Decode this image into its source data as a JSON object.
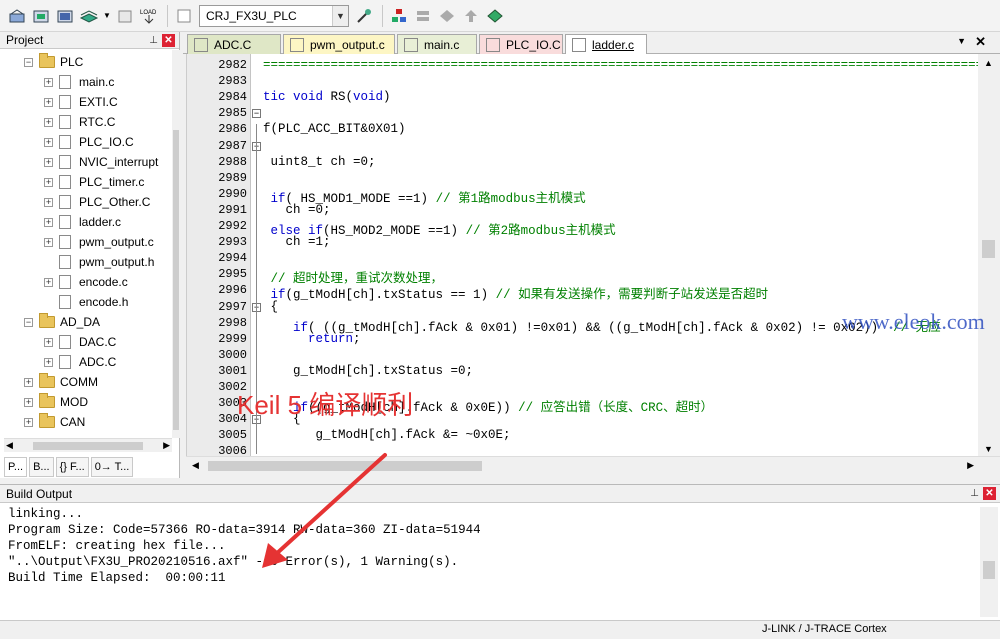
{
  "toolbar": {
    "target_combo": "CRJ_FX3U_PLC"
  },
  "project": {
    "title": "Project",
    "pin_icon": "pin-icon",
    "tree": [
      {
        "label": "PLC",
        "kind": "folder",
        "expanded": true,
        "level": 1
      },
      {
        "label": "main.c",
        "kind": "file",
        "level": 2
      },
      {
        "label": "EXTI.C",
        "kind": "file",
        "level": 2
      },
      {
        "label": "RTC.C",
        "kind": "file",
        "level": 2
      },
      {
        "label": "PLC_IO.C",
        "kind": "file",
        "level": 2
      },
      {
        "label": "NVIC_interrupt",
        "kind": "file",
        "level": 2
      },
      {
        "label": "PLC_timer.c",
        "kind": "file",
        "level": 2
      },
      {
        "label": "PLC_Other.C",
        "kind": "file",
        "level": 2
      },
      {
        "label": "ladder.c",
        "kind": "file",
        "level": 2
      },
      {
        "label": "pwm_output.c",
        "kind": "file",
        "level": 2
      },
      {
        "label": "pwm_output.h",
        "kind": "header",
        "level": 2
      },
      {
        "label": "encode.c",
        "kind": "file",
        "level": 2
      },
      {
        "label": "encode.h",
        "kind": "header",
        "level": 2
      },
      {
        "label": "AD_DA",
        "kind": "folder",
        "expanded": true,
        "level": 1
      },
      {
        "label": "DAC.C",
        "kind": "file",
        "level": 2
      },
      {
        "label": "ADC.C",
        "kind": "file",
        "level": 2
      },
      {
        "label": "COMM",
        "kind": "folder",
        "expanded": false,
        "level": 1
      },
      {
        "label": "MOD",
        "kind": "folder",
        "expanded": false,
        "level": 1
      },
      {
        "label": "CAN",
        "kind": "folder",
        "expanded": false,
        "level": 1
      }
    ],
    "bottom_tabs": [
      "P...",
      "B...",
      "{} F...",
      "0→ T..."
    ]
  },
  "editor": {
    "tabs": [
      {
        "label": "ADC.C",
        "color": "#dfe7c6"
      },
      {
        "label": "pwm_output.c",
        "color": "#fdf6c4"
      },
      {
        "label": "main.c",
        "color": "#e8efd6"
      },
      {
        "label": "PLC_IO.C",
        "color": "#f9dcdc"
      },
      {
        "label": "ladder.c",
        "color": "#ffffff"
      }
    ],
    "close": "✕",
    "lines": [
      {
        "n": "2982",
        "html": "<span class=\"cm\">=========================================================================================================</span>"
      },
      {
        "n": "2983",
        "html": ""
      },
      {
        "n": "2984",
        "html": "<span class=\"kw\">tic void</span> RS(<span class=\"kw\">void</span>)"
      },
      {
        "n": "2985",
        "html": ""
      },
      {
        "n": "2986",
        "html": "f(PLC_ACC_BIT&amp;0X01)"
      },
      {
        "n": "2987",
        "html": ""
      },
      {
        "n": "2988",
        "html": " uint8_t ch =0;"
      },
      {
        "n": "2989",
        "html": ""
      },
      {
        "n": "2990",
        "html": " <span class=\"kw\">if</span>( HS_MOD1_MODE ==1) <span class=\"cm\">// 第1路modbus主机模式</span>"
      },
      {
        "n": "2991",
        "html": "   ch =0;"
      },
      {
        "n": "2992",
        "html": " <span class=\"kw\">else if</span>(HS_MOD2_MODE ==1) <span class=\"cm\">// 第2路modbus主机模式</span>"
      },
      {
        "n": "2993",
        "html": "   ch =1;"
      },
      {
        "n": "2994",
        "html": ""
      },
      {
        "n": "2995",
        "html": " <span class=\"cm\">// 超时处理，重试次数处理，</span>"
      },
      {
        "n": "2996",
        "html": " <span class=\"kw\">if</span>(g_tModH[ch].txStatus == 1) <span class=\"cm\">// 如果有发送操作，需要判断子站发送是否超时</span>"
      },
      {
        "n": "2997",
        "html": " {"
      },
      {
        "n": "2998",
        "html": "    <span class=\"kw\">if</span>( ((g_tModH[ch].fAck &amp; 0x01) !=0x01) &amp;&amp; ((g_tModH[ch].fAck &amp; 0x02) != 0x02))  <span class=\"cm\">// 无应</span>"
      },
      {
        "n": "2999",
        "html": "      <span class=\"kw\">return</span>;"
      },
      {
        "n": "3000",
        "html": ""
      },
      {
        "n": "3001",
        "html": "    g_tModH[ch].txStatus =0;"
      },
      {
        "n": "3002",
        "html": ""
      },
      {
        "n": "3003",
        "html": "    <span class=\"kw\">if</span>((g_tModH[ch].fAck &amp; 0x0E)) <span class=\"cm\">// 应答出错（长度、CRC、超时）</span>"
      },
      {
        "n": "3004",
        "html": "    {"
      },
      {
        "n": "3005",
        "html": "       g_tModH[ch].fAck &amp;= ~0x0E;"
      },
      {
        "n": "3006",
        "html": ""
      }
    ],
    "folds": [
      2985,
      2987,
      2997,
      3004
    ]
  },
  "build": {
    "title": "Build Output",
    "lines": [
      "linking...",
      "Program Size: Code=57366 RO-data=3914 RW-data=360 ZI-data=51944",
      "FromELF: creating hex file...",
      "\"..\\Output\\FX3U_PRO20210516.axf\" - 0 Error(s), 1 Warning(s).",
      "Build Time Elapsed:  00:00:11"
    ]
  },
  "status": {
    "target": "J-LINK / J-TRACE Cortex"
  },
  "overlay": {
    "watermark": "www.eleok.com",
    "annotation": "Keil 5 编译顺利",
    "arrow_color": "#e53333"
  }
}
